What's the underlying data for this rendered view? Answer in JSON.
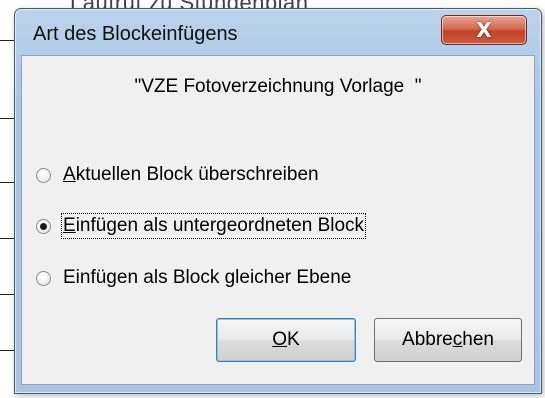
{
  "background": {
    "partial_text": "Laufruf zu Stundenplan"
  },
  "dialog": {
    "title": "Art des Blockeinfügens",
    "close_glyph": "X",
    "message": "\"VZE Fotoverzeichnung Vorlage  \"",
    "options": [
      {
        "pre": "",
        "mnemonic": "A",
        "post": "ktuellen Block überschreiben",
        "selected": false
      },
      {
        "pre": "",
        "mnemonic": "E",
        "post": "infügen als untergeordneten Block",
        "selected": true
      },
      {
        "pre": "Einfügen als Block gleicher Ebene",
        "mnemonic": "",
        "post": "",
        "selected": false
      }
    ],
    "ok_button": {
      "mnemonic": "O",
      "rest": "K"
    },
    "cancel_button": {
      "pre": "Abbre",
      "mnemonic": "c",
      "post": "hen"
    }
  },
  "colors": {
    "title_bar": "#aac6e6",
    "close_button": "#c3432a",
    "client_area": "#f0f0f0"
  }
}
